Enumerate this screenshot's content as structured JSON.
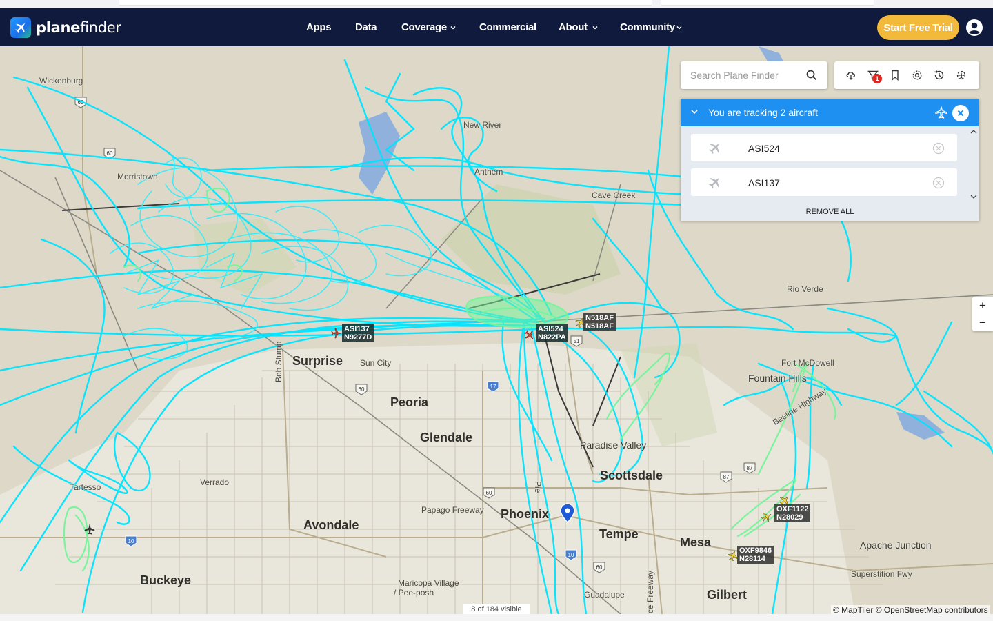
{
  "brand": {
    "logo_prefix": "plane",
    "logo_suffix": "finder",
    "accent": "#1e90f2",
    "nav_bg": "#0f1a3d",
    "trial_color": "#f3b93a"
  },
  "nav": {
    "apps": "Apps",
    "data": "Data",
    "coverage": "Coverage",
    "commercial": "Commercial",
    "about": "About",
    "community": "Community",
    "trial": "Start Free Trial"
  },
  "search": {
    "placeholder": "Search Plane Finder"
  },
  "toolbar": {
    "filter_badge": "1",
    "icons": [
      "weather-icon",
      "filter-icon",
      "bookmark-icon",
      "settings-icon",
      "history-icon",
      "airport-icon"
    ]
  },
  "tracking": {
    "title": "You are tracking 2 aircraft",
    "aircraft": [
      {
        "callsign": "ASI524"
      },
      {
        "callsign": "ASI137"
      }
    ],
    "remove_all": "REMOVE ALL"
  },
  "zoom": {
    "in": "+",
    "out": "−"
  },
  "map": {
    "places": {
      "wickenburg": "Wickenburg",
      "morristown": "Morristown",
      "new_river": "New River",
      "anthem": "Anthem",
      "cave_creek": "Cave Creek",
      "rio_verde": "Rio Verde",
      "fort_mcdowell": "Fort McDowell",
      "fountain_hills": "Fountain Hills",
      "beeline": "Beeline Highway",
      "surprise": "Surprise",
      "sun_city": "Sun City",
      "peoria": "Peoria",
      "glendale": "Glendale",
      "paradise_valley": "Paradise Valley",
      "scottsdale": "Scottsdale",
      "verrado": "Verrado",
      "tartesso": "Tartesso",
      "papago": "Papago Freeway",
      "phoenix": "Phoenix",
      "avondale": "Avondale",
      "tempe": "Tempe",
      "mesa": "Mesa",
      "apache_junction": "Apache Junction",
      "superstition": "Superstition Fwy",
      "buckeye": "Buckeye",
      "maricopa": "Maricopa Village",
      "peeposh": "/ Pee-posh",
      "guadalupe": "Guadalupe",
      "gilbert": "Gilbert",
      "bob_stump": "Bob Stump",
      "piestewa": "Pie",
      "fwy": "ce Freeway"
    },
    "routes": [
      "60",
      "60",
      "17",
      "60",
      "51",
      "87",
      "87",
      "10",
      "10",
      "60",
      "60"
    ],
    "aircraft_labels": [
      {
        "callsign": "ASI137",
        "reg": "N9277D"
      },
      {
        "callsign": "ASI524",
        "reg": "N822PA"
      },
      {
        "callsign": "N518AF",
        "reg": "N518AF"
      },
      {
        "callsign": "OXF1122",
        "reg": "N28029"
      },
      {
        "callsign": "OXF9846",
        "reg": "N28114"
      }
    ],
    "visible_count": "8 of 184 visible",
    "attribution": "© MapTiler © OpenStreetMap contributors"
  }
}
